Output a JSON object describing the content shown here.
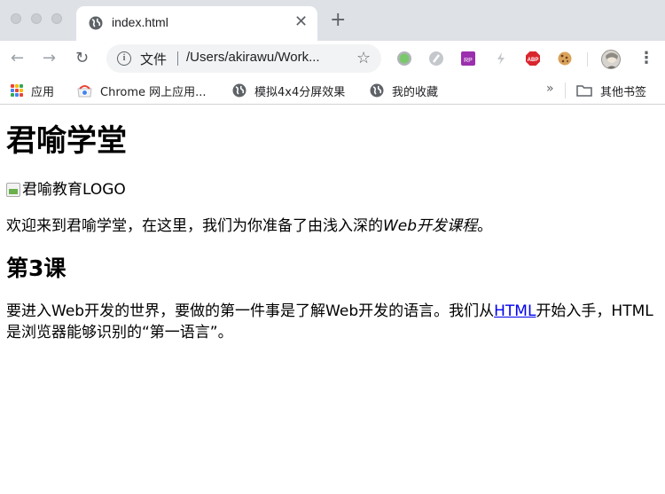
{
  "window": {
    "tab": {
      "title": "index.html",
      "close_glyph": "✕"
    },
    "new_tab_glyph": "+"
  },
  "toolbar": {
    "back_glyph": "←",
    "forward_glyph": "→",
    "reload_glyph": "↻",
    "omnibox": {
      "scheme_label": "文件",
      "url": "/Users/akirawu/Work...",
      "info_glyph": "i",
      "star_glyph": "☆"
    },
    "extensions": [
      "green-circle-icon",
      "wand-icon",
      "rp-icon",
      "lightning-icon",
      "adblock-icon",
      "cookie-icon"
    ],
    "abp_label": "ABP",
    "rp_label": "RP",
    "menu_glyph": "⋮"
  },
  "bookmarks": {
    "items": [
      {
        "label": "应用",
        "icon": "apps-grid-icon"
      },
      {
        "label": "Chrome 网上应用...",
        "icon": "chrome-store-icon"
      },
      {
        "label": "模拟4x4分屏效果",
        "icon": "globe-icon"
      },
      {
        "label": "我的收藏",
        "icon": "globe-icon"
      }
    ],
    "overflow_glyph": "»",
    "other_folder": "其他书签"
  },
  "page": {
    "title": "君喻学堂",
    "logo_alt": "君喻教育LOGO",
    "intro_text": "欢迎来到君喻学堂，在这里，我们为你准备了由浅入深的",
    "intro_em": "Web开发课程",
    "intro_end": "。",
    "lesson_heading": "第3课",
    "para_before_link": "要进入Web开发的世界，要做的第一件事是了解Web开发的语言。我们从",
    "para_link": "HTML",
    "para_after_link": "开始入手，HTML是浏览器能够识别的“第一语言”。"
  },
  "colors": {
    "tabstrip": "#dee1e6",
    "link": "#0000ee",
    "abp_red": "#d9262e",
    "rp_purple": "#9b2fae"
  }
}
